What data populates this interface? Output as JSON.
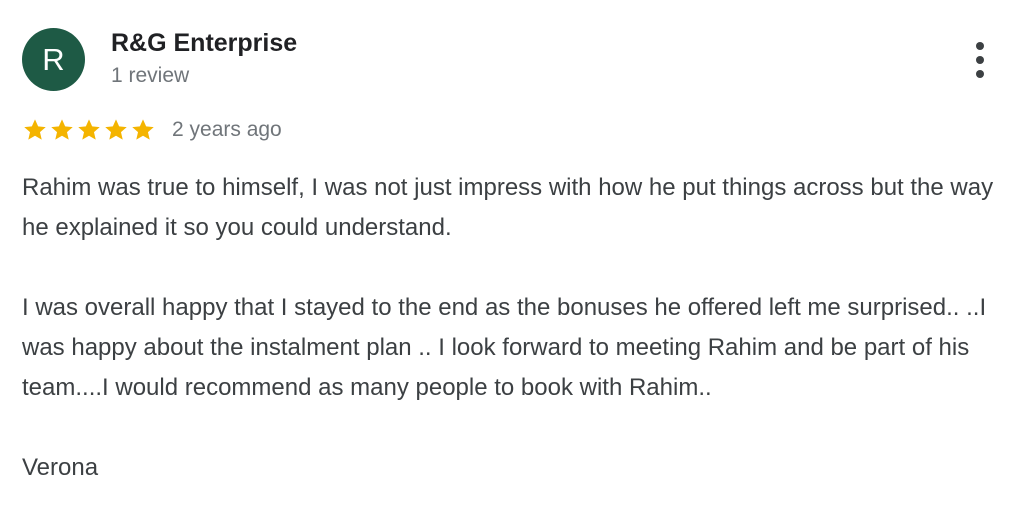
{
  "review": {
    "author": {
      "initial": "R",
      "name": "R&G Enterprise",
      "review_count": "1 review",
      "avatar_color": "#1e5a45"
    },
    "rating": 5,
    "rating_max": 5,
    "star_color": "#f4b400",
    "time": "2 years ago",
    "menu_icon": "more-vert-icon",
    "paragraphs": [
      "Rahim was true to himself, I was not just impress with how he put things across but the way he explained it so you could understand.",
      "I was overall happy that I stayed to the end as the bonuses he offered left me surprised.. ..I was happy about the instalment plan .. I look forward to meeting Rahim and be part of his team....I would recommend as many people to book with Rahim..",
      "Verona"
    ]
  }
}
